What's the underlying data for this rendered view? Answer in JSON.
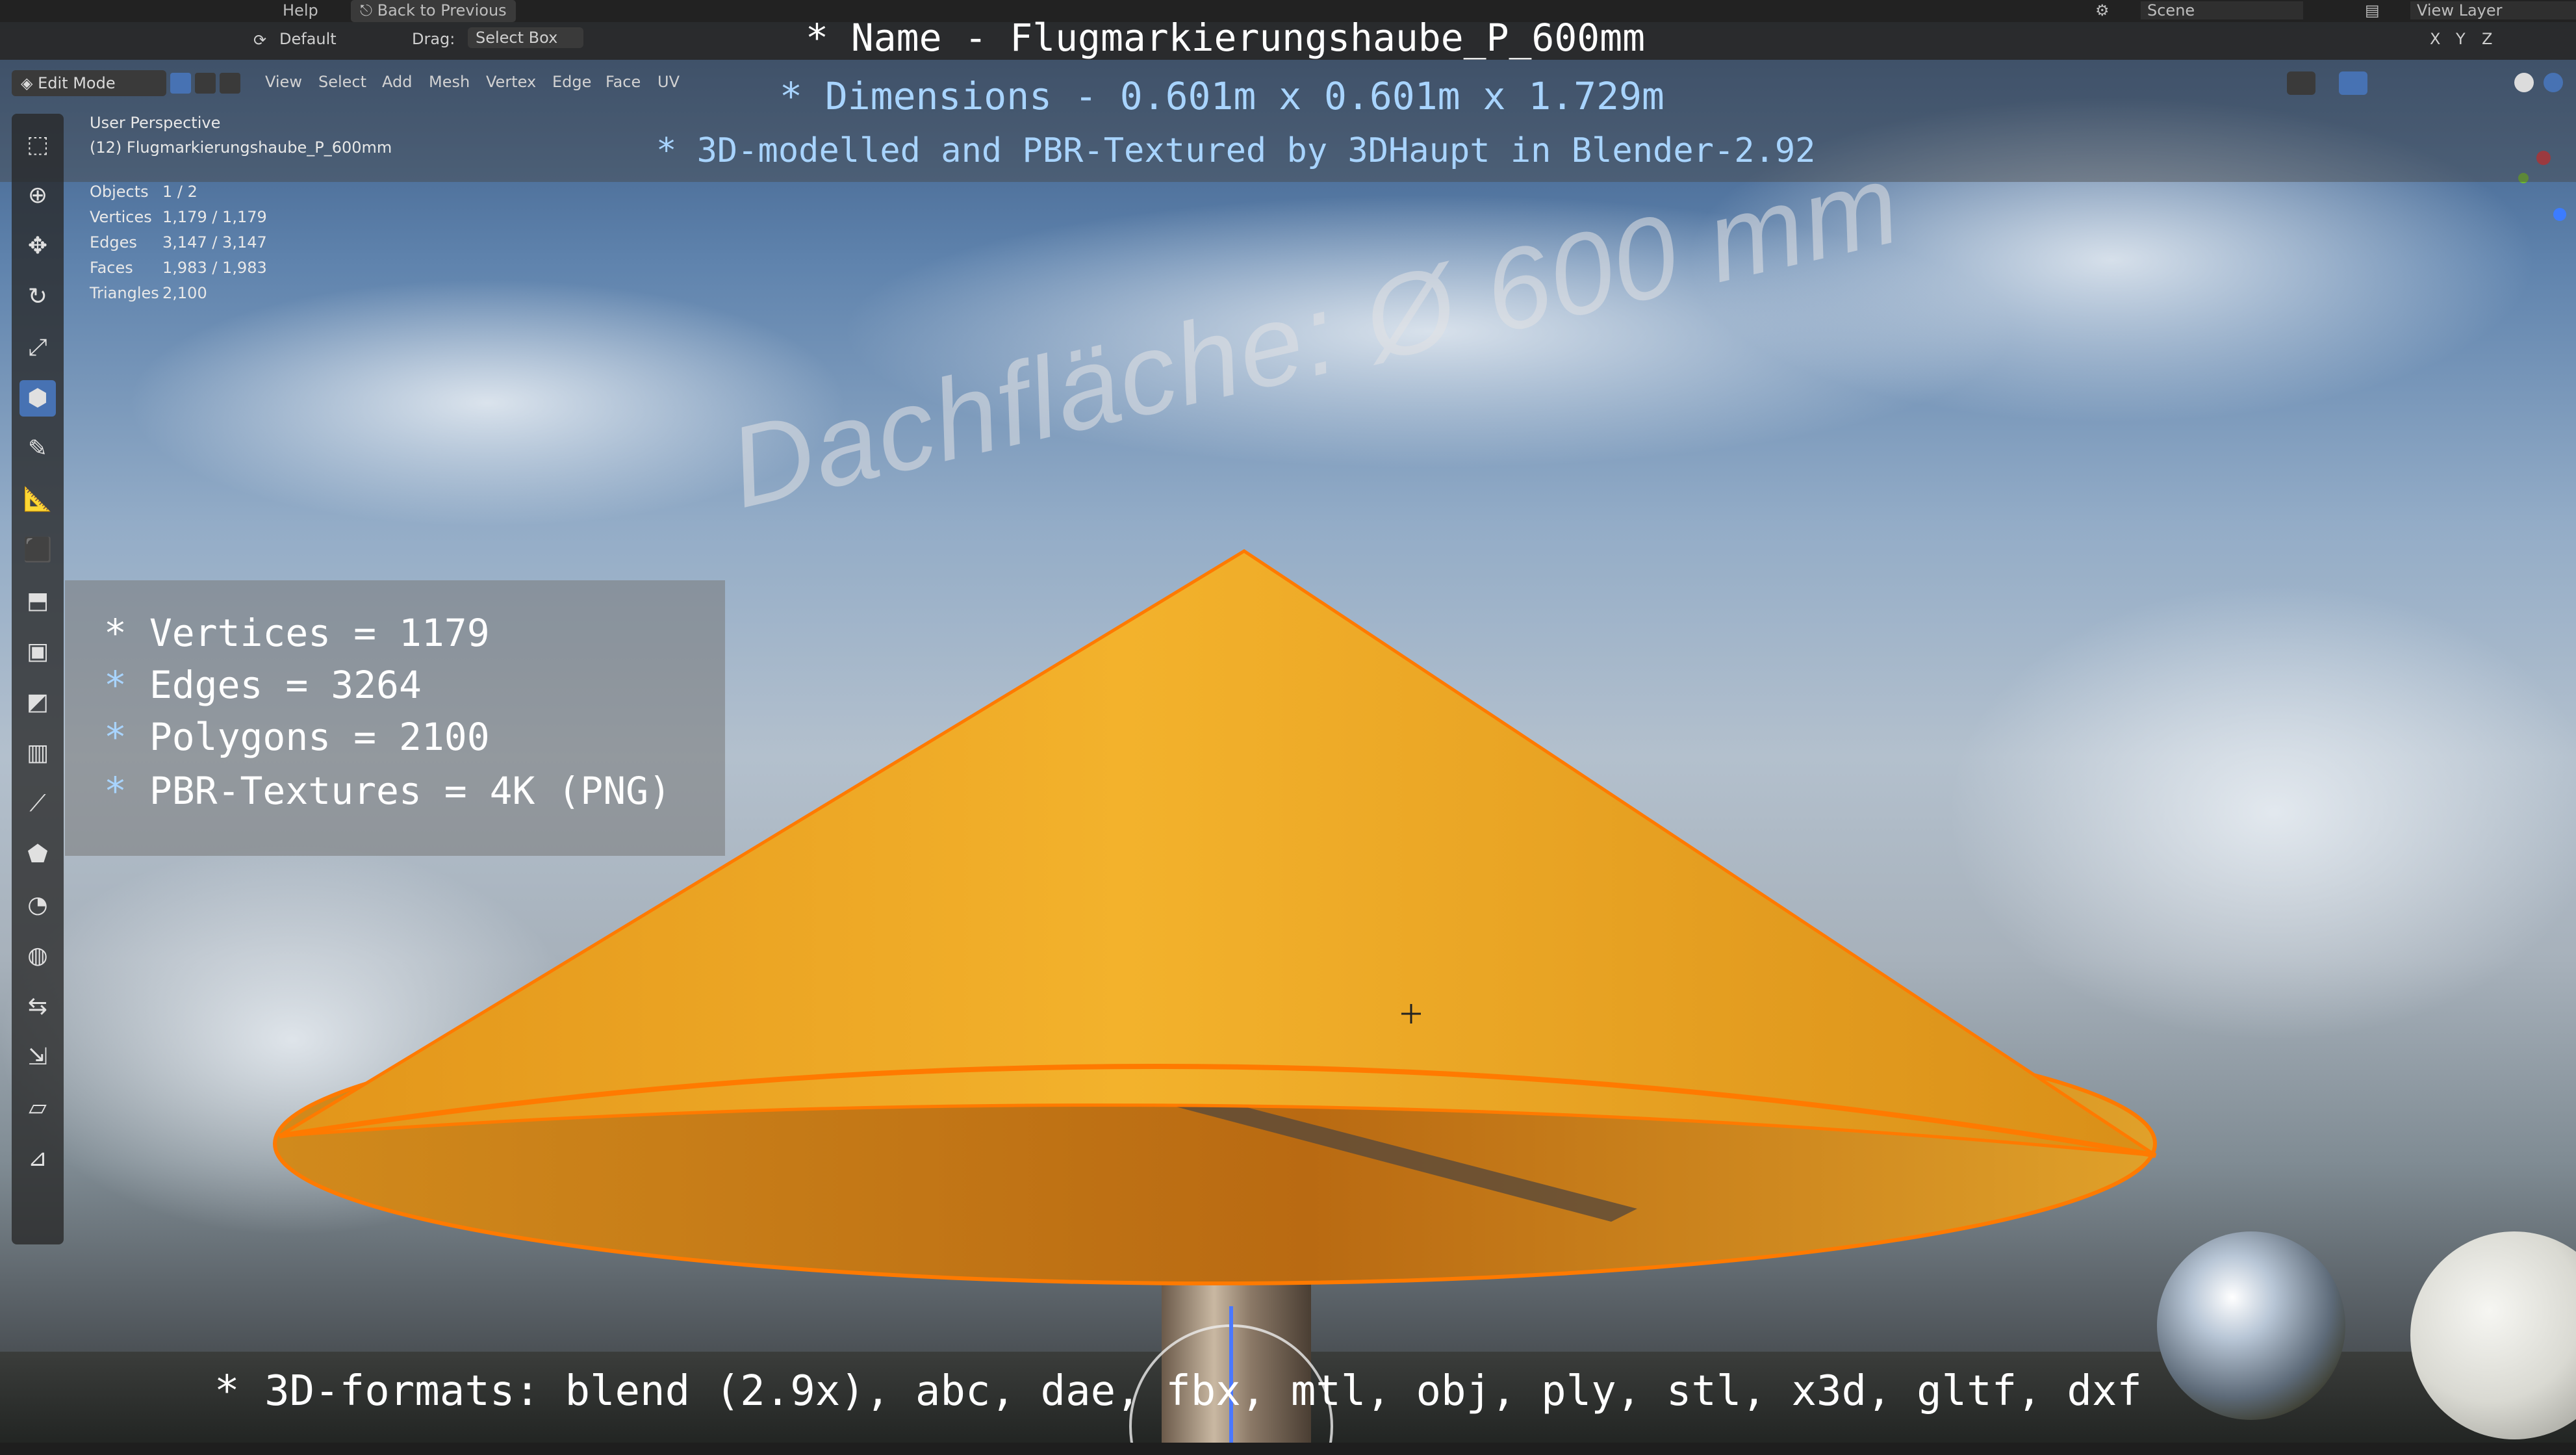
{
  "topbar": {
    "menu_help": "Help",
    "back_button": "Back to Previous",
    "scene_label": "Scene",
    "view_layer_label": "View Layer"
  },
  "header": {
    "orientation_preset": "Default",
    "drag_label": "Drag:",
    "drag_value": "Select Box"
  },
  "modebar": {
    "mode": "Edit Mode",
    "menus": [
      "View",
      "Select",
      "Add",
      "Mesh",
      "Vertex",
      "Edge",
      "Face",
      "UV"
    ]
  },
  "viewport_info": {
    "perspective": "User Perspective",
    "object_label": "(12) Flugmarkierungshaube_P_600mm",
    "stats": [
      {
        "k": "Objects",
        "v": "1 / 2"
      },
      {
        "k": "Vertices",
        "v": "1,179 / 1,179"
      },
      {
        "k": "Edges",
        "v": "3,147 / 3,147"
      },
      {
        "k": "Faces",
        "v": "1,983 / 1,983"
      },
      {
        "k": "Triangles",
        "v": "2,100"
      }
    ]
  },
  "overlay": {
    "name_line": "* Name - Flugmarkierungshaube_P_600mm",
    "dimensions_line": "* Dimensions -  0.601m x 0.601m x 1.729m",
    "model_line": "* 3D-modelled and PBR-Textured by 3DHaupt in Blender-2.92",
    "stats_lines": [
      {
        "star": "*",
        "text": " Vertices = 1179"
      },
      {
        "star": "*",
        "text": " Edges = 3264"
      },
      {
        "star": "*",
        "text": " Polygons = 2100"
      },
      {
        "star": "*",
        "text": " PBR-Textures = 4K (PNG)"
      }
    ],
    "formats_line": "* 3D-formats: blend (2.9x), abc, dae, fbx, mtl, obj, ply, stl, x3d, gltf, dxf",
    "dach_text": "Dachfläche:  Ø 600 mm"
  },
  "tools": [
    "select-box-icon",
    "cursor-icon",
    "move-icon",
    "rotate-icon",
    "scale-icon",
    "transform-icon",
    "annotate-icon",
    "measure-icon",
    "add-cube-icon",
    "extrude-icon",
    "inset-icon",
    "bevel-icon",
    "loop-cut-icon",
    "knife-icon",
    "poly-build-icon",
    "spin-icon",
    "smooth-icon",
    "edge-slide-icon",
    "shrink-fatten-icon",
    "shear-icon",
    "rip-icon"
  ],
  "colors": {
    "cone": "#f0a820",
    "edge": "#ff7a00",
    "accent": "#4772b3",
    "title_blue": "#a8d4ff"
  }
}
